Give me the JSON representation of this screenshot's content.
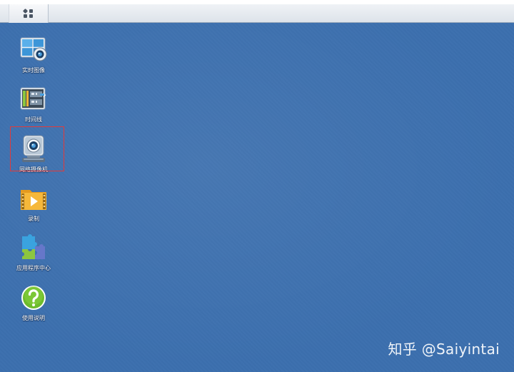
{
  "desktop": {
    "background_color": "#3c6fae",
    "items": [
      {
        "label": "实时图像",
        "icon": "live-view-icon"
      },
      {
        "label": "时间线",
        "icon": "timeline-icon"
      },
      {
        "label": "网络摄像机",
        "icon": "ip-camera-icon"
      },
      {
        "label": "录制",
        "icon": "recording-folder-icon"
      },
      {
        "label": "应用程序中心",
        "icon": "puzzle-icon"
      },
      {
        "label": "使用说明",
        "icon": "help-icon"
      }
    ],
    "highlighted_item": "网络摄像机",
    "highlight_color": "#e23a3a"
  },
  "taskbar": {
    "main_menu_icon": "main-menu-icon"
  },
  "watermark": {
    "text": "知乎 @Saiyintai"
  }
}
